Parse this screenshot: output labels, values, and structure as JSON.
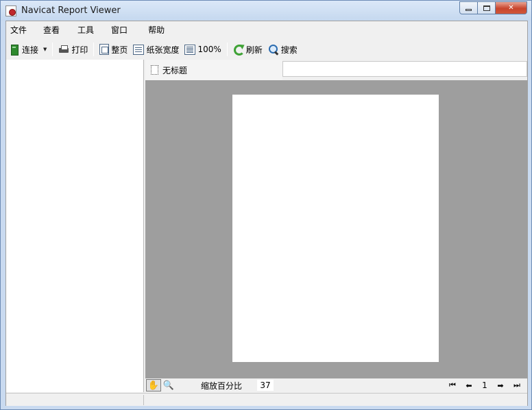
{
  "window": {
    "title": "Navicat Report Viewer",
    "controls": {
      "minimize": "minimize",
      "maximize": "maximize",
      "close": "✕"
    }
  },
  "menu": [
    "文件",
    "查看",
    "工具",
    "窗口",
    "帮助"
  ],
  "toolbar": {
    "connect": "连接",
    "print": "打印",
    "whole_page": "整页",
    "page_width": "纸张宽度",
    "zoom_100": "100%",
    "refresh": "刷新",
    "search": "搜索"
  },
  "tabs": [
    {
      "label": "无标题"
    }
  ],
  "zoombar": {
    "zoom_label": "缩放百分比",
    "zoom_value": "37",
    "page_number": "1"
  },
  "icons": {
    "connect": "database-connect-icon",
    "print": "printer-icon",
    "whole_page": "whole-page-icon",
    "page_width": "page-width-icon",
    "zoom_100": "full-size-icon",
    "refresh": "refresh-icon",
    "search": "magnifier-icon"
  },
  "colors": {
    "preview_background": "#9e9e9e",
    "paper": "#ffffff",
    "refresh_green": "#3ea235"
  }
}
